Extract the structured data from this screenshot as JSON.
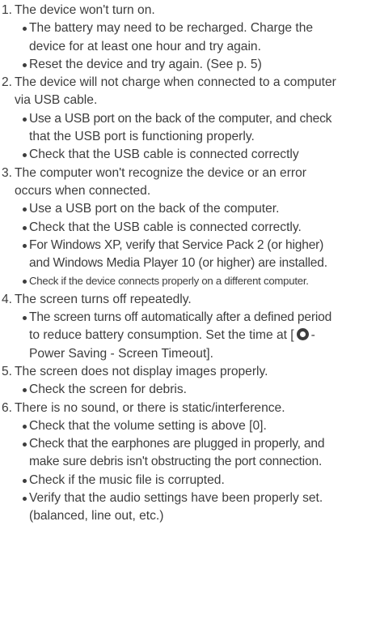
{
  "items": [
    {
      "number": "1.",
      "lines": [
        "The device won't turn on."
      ],
      "bullets": [
        [
          "The battery may need to be recharged. Charge the",
          "device for at least one hour and try again."
        ],
        [
          "Reset the device and try again. (See p. 5)"
        ]
      ]
    },
    {
      "number": "2.",
      "lines": [
        "The device will not charge when connected to a computer",
        "via USB cable."
      ],
      "bullets": [
        [
          "Use a USB port on the back of the computer, and check",
          "that the USB port is functioning properly."
        ],
        [
          "Check that the USB cable is connected correctly"
        ]
      ]
    },
    {
      "number": "3.",
      "lines": [
        "The computer won't recognize the device or an error",
        "occurs when connected."
      ],
      "bullets": [
        [
          "Use a USB port on the back of the computer."
        ],
        [
          "Check that the USB cable is connected correctly."
        ],
        [
          "For Windows XP, verify that Service Pack 2 (or higher)",
          "and Windows Media Player 10 (or higher) are installed."
        ],
        [
          "Check if the device connects properly on a different computer."
        ]
      ]
    },
    {
      "number": "4.",
      "lines": [
        "The screen turns off repeatedly."
      ],
      "bullets": [
        {
          "line1": "The screen turns off automatically after a defined period",
          "line2_before": "to reduce battery consumption. Set the time at [",
          "icon": "gear-icon",
          "line2_after": "-",
          "line3": "Power Saving - Screen Timeout]."
        }
      ]
    },
    {
      "number": "5.",
      "lines": [
        "The screen does not display images properly."
      ],
      "bullets": [
        [
          "Check the screen for debris."
        ]
      ]
    },
    {
      "number": "6.",
      "lines": [
        "There is no sound, or there is static/interference."
      ],
      "bullets": [
        [
          "Check that the volume setting is above [0]."
        ],
        [
          "Check that the earphones are plugged in properly, and",
          "make sure debris isn't obstructing the port connection."
        ],
        [
          "Check if the music file is corrupted."
        ],
        [
          "Verify that the audio settings have been properly set.",
          "(balanced, line out, etc.)"
        ]
      ]
    }
  ]
}
